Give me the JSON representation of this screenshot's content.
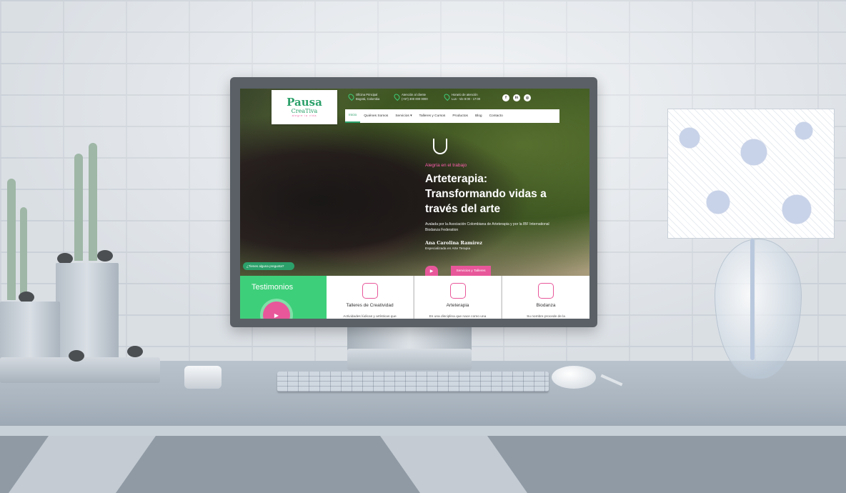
{
  "site": {
    "logo": {
      "main": "Pausa",
      "sub": "CreaTiva",
      "tag": "alegre la vida"
    },
    "info": [
      {
        "line1": "Oficina Principal",
        "line2": "Bogotá, Colombia"
      },
      {
        "line1": "Atención al cliente",
        "line2": "(+57) 300 000 0000"
      },
      {
        "line1": "Horario de atención",
        "line2": "Lun - Vie 8:00 - 17:00"
      }
    ],
    "social": [
      "f",
      "in",
      "◎"
    ],
    "nav": [
      "Inicio",
      "Quiénes Somos",
      "Servicios ▾",
      "Talleres y Cursos",
      "Productos",
      "Blog",
      "Contacto"
    ],
    "hero": {
      "kicker": "Alegría en el trabajo",
      "title": "Arteterapia: Transformando vidas a través del arte",
      "description": "Avalada por la Asociación Colombiana de Arteterapia y por la IBF International Biodanza Federation",
      "name": "Ana Carolina Ramírez",
      "role": "Especializada en Arte Terapia",
      "cta": "Servicios y Talleres",
      "play": "▶"
    },
    "question": "¿Tienes alguna pregunta?",
    "testimonials": {
      "title": "Testimonios",
      "play": "▶"
    },
    "cards": [
      {
        "title": "Talleres de Creatividad",
        "text": "Actividades lúdicas y artísticas que"
      },
      {
        "title": "Arteterapia",
        "text": "Es una disciplina que nace como una"
      },
      {
        "title": "Biodanza",
        "text": "Su nombre procede de la"
      }
    ]
  },
  "colors": {
    "green": "#3ecf7a",
    "pink": "#e8579a",
    "dark_green": "#2ca06a"
  }
}
